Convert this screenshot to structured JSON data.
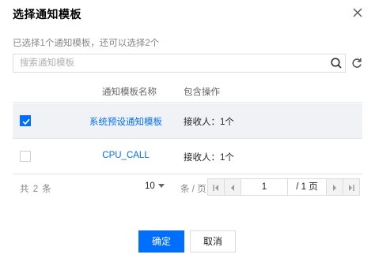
{
  "dialog": {
    "title": "选择通知模板",
    "hint": "已选择1个通知模板，还可以选择2个"
  },
  "search": {
    "placeholder": "搜索通知模板",
    "value": ""
  },
  "table": {
    "columns": [
      "通知模板名称",
      "包含操作"
    ],
    "rows": [
      {
        "name": "系统预设通知模板",
        "ops": "接收人：1个",
        "checked": true
      },
      {
        "name": "CPU_CALL",
        "ops": "接收人：1个",
        "checked": false
      }
    ]
  },
  "pagination": {
    "total": "共 2 条",
    "page_size": "10",
    "per_page_unit": "条 / 页",
    "current_page": "1",
    "total_pages": "/ 1 页"
  },
  "footer": {
    "ok_label": "确定",
    "cancel_label": "取消"
  },
  "colors": {
    "primary": "#006eff",
    "selected_row": "#f1f2f5"
  }
}
